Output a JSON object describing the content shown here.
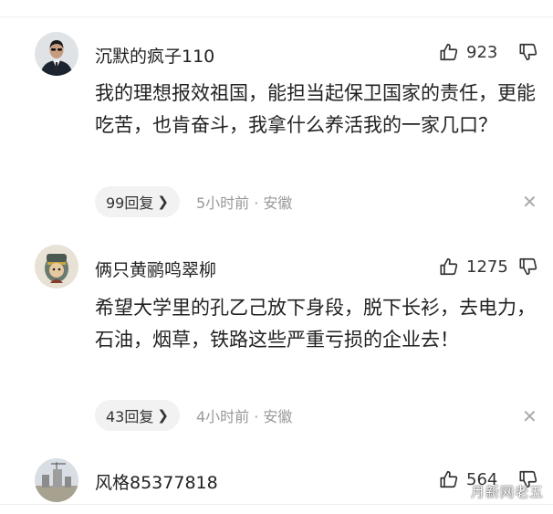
{
  "comments": [
    {
      "username": "沉默的疯子110",
      "likes": "923",
      "text": "我的理想报效祖国，能担当起保卫国家的责任，更能吃苦，也肯奋斗，我拿什么养活我的一家几口？",
      "reply_label": "99回复",
      "time_location": "5小时前 · 安徽"
    },
    {
      "username": "俩只黄鹂鸣翠柳",
      "likes": "1275",
      "text": "希望大学里的孔乙己放下身段，脱下长衫，去电力，石油，烟草，铁路这些严重亏损的企业去！",
      "reply_label": "43回复",
      "time_location": "4小时前 · 安徽"
    },
    {
      "username": "风格85377818",
      "likes": "564"
    }
  ],
  "watermark": "月新网老五",
  "icons": {
    "like": "thumbs-up-icon",
    "dislike": "thumbs-down-icon",
    "close": "close-icon",
    "chevron": "chevron-right-icon"
  }
}
